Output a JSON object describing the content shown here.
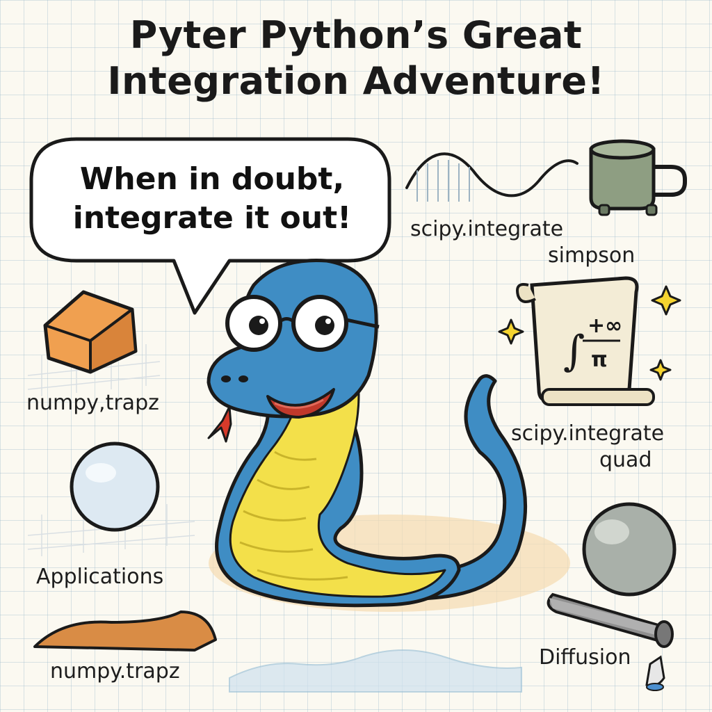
{
  "title": {
    "line1": "Pyter Python’s Great",
    "line2": "Integration Adventure!"
  },
  "speech_bubble": {
    "line1": "When in doubt,",
    "line2": "integrate it out!"
  },
  "labels": {
    "scipy_simpson_line1": "scipy.integrate",
    "scipy_simpson_line2": "simpson",
    "scipy_quad_line1": "scipy.integrate",
    "scipy_quad_line2": "quad",
    "numpy_trapz_comma": "numpy,trapz",
    "applications": "Applications",
    "numpy_trapz": "numpy.trapz",
    "diffusion": "Diffusion"
  },
  "scroll": {
    "formula_top": "+∞",
    "formula_bottom": "π",
    "integral_sign": "∫"
  },
  "colors": {
    "snake_blue": "#3f8dc4",
    "snake_belly": "#f3e04a",
    "outline": "#1a1a1a",
    "cube_orange": "#f0a050",
    "sphere_light": "#dde9f2",
    "sphere_gray": "#a9b0a9",
    "mug_green": "#8e9e82"
  }
}
